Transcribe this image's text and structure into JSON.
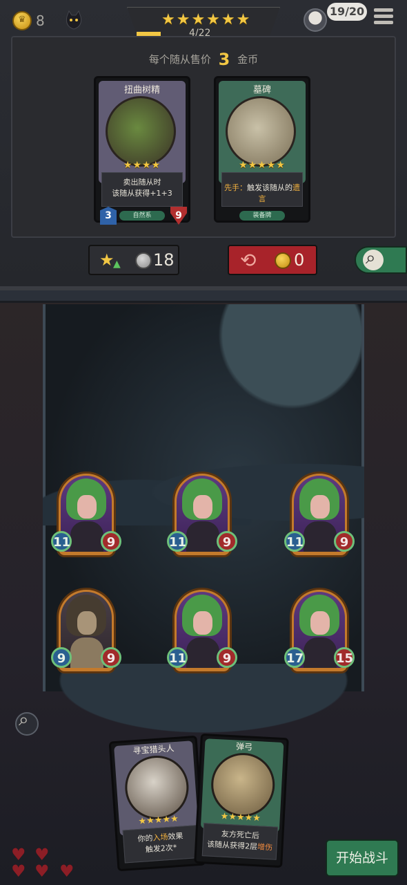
{
  "hud": {
    "gold": "8",
    "tier_stars": "★★★★★★",
    "tier_progress": "4/22",
    "tier_progress_fraction": 0.18,
    "trade_count": "19/20",
    "icons": [
      "coin-icon",
      "cat-icon",
      "avatar-icon",
      "menu-icon"
    ]
  },
  "shop": {
    "sell_prefix": "每个随从售价",
    "sell_price": "3",
    "sell_suffix": "金币",
    "cards": [
      {
        "name": "扭曲树精",
        "stars": "★★★★",
        "desc_line1": "卖出随从时",
        "desc_line2": "该随从获得+1+3",
        "tag": "自然系",
        "attack": "3",
        "health": "9",
        "color": "#5c5a6e"
      },
      {
        "name": "墓碑",
        "stars": "★★★★★",
        "desc_prefix": "先手：",
        "desc_text": "触发该随从的",
        "desc_hl": "遗言",
        "tag": "装备牌",
        "color": "#3b6b55"
      }
    ],
    "upgrade_cost": "18",
    "refresh_cost": "0"
  },
  "board": {
    "row1": [
      {
        "attack": "11",
        "health": "9",
        "kind": "siren"
      },
      {
        "attack": "11",
        "health": "9",
        "kind": "siren"
      },
      {
        "attack": "11",
        "health": "9",
        "kind": "siren"
      }
    ],
    "row2": [
      {
        "attack": "9",
        "health": "9",
        "kind": "voodoo"
      },
      {
        "attack": "11",
        "health": "9",
        "kind": "siren"
      },
      {
        "attack": "17",
        "health": "15",
        "kind": "siren"
      }
    ]
  },
  "hand": [
    {
      "name": "寻宝猎头人",
      "stars": "★★★★★",
      "desc_l1_pre": "你的",
      "desc_l1_hl": "入场",
      "desc_l1_post": "效果",
      "desc_l2": "触发2次*",
      "color": "#5c5a6e"
    },
    {
      "name": "弹弓",
      "stars": "★★★★★",
      "desc_l1": "友方死亡后",
      "desc_l2_pre": "该随从获得2层",
      "desc_l2_hl": "增伤",
      "color": "#3b6b55"
    }
  ],
  "lives": {
    "hearts": 5
  },
  "start_button": "开始战斗"
}
